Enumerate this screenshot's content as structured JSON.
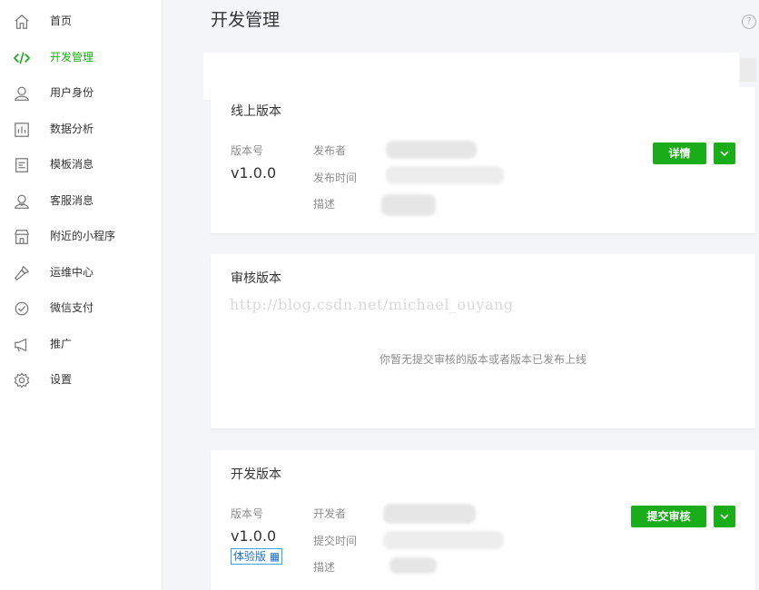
{
  "sidebar": {
    "items": [
      {
        "label": "首页",
        "icon": "home-icon"
      },
      {
        "label": "开发管理",
        "icon": "code-icon",
        "active": true
      },
      {
        "label": "用户身份",
        "icon": "user-icon"
      },
      {
        "label": "数据分析",
        "icon": "chart-icon"
      },
      {
        "label": "模板消息",
        "icon": "template-icon"
      },
      {
        "label": "客服消息",
        "icon": "support-icon"
      },
      {
        "label": "附近的小程序",
        "icon": "store-icon"
      },
      {
        "label": "运维中心",
        "icon": "wrench-icon"
      },
      {
        "label": "微信支付",
        "icon": "pay-icon"
      },
      {
        "label": "推广",
        "icon": "megaphone-icon"
      },
      {
        "label": "设置",
        "icon": "gear-icon"
      }
    ],
    "active_color": "#1aad19"
  },
  "header": {
    "title": "开发管理",
    "help": "?"
  },
  "online_version": {
    "title": "线上版本",
    "version_label": "版本号",
    "version": "v1.0.0",
    "publisher_label": "发布者",
    "publish_time_label": "发布时间",
    "description_label": "描述",
    "detail_button": "详情"
  },
  "review_version": {
    "title": "审核版本",
    "watermark": "http://blog.csdn.net/michael_ouyang",
    "empty_message": "你暂无提交审核的版本或者版本已发布上线"
  },
  "dev_version": {
    "title": "开发版本",
    "version_label": "版本号",
    "version": "v1.0.0",
    "trial_link": "体验版 ▦",
    "developer_label": "开发者",
    "submit_time_label": "提交时间",
    "description_label": "描述",
    "submit_button": "提交审核"
  },
  "colors": {
    "accent": "#1aad19",
    "link": "#1e71c4",
    "background": "#f4f5f9"
  }
}
